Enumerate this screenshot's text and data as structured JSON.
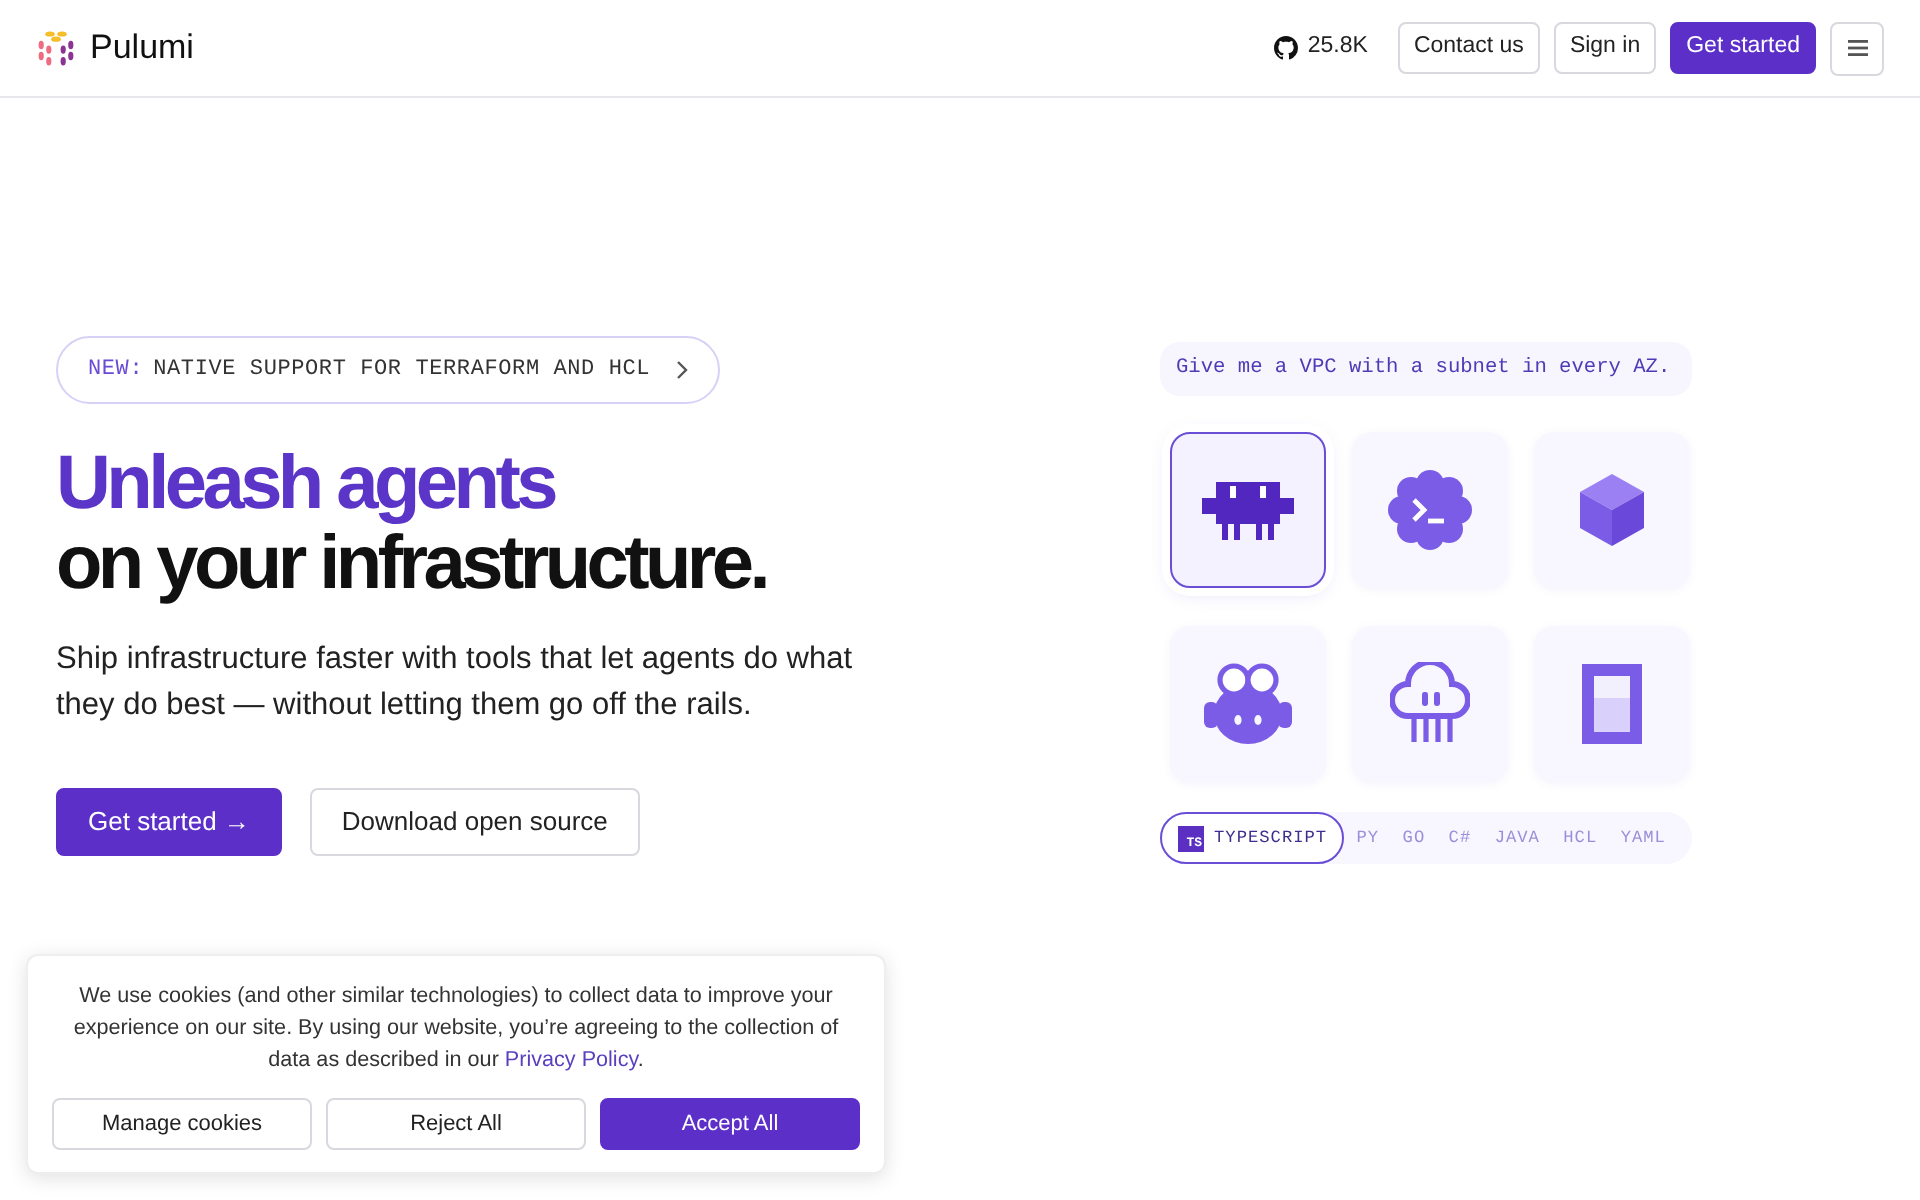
{
  "header": {
    "brand": "Pulumi",
    "github_stars": "25.8K",
    "buttons": [
      {
        "label": "Contact us",
        "kind": "outline"
      },
      {
        "label": "Sign in",
        "kind": "outline"
      },
      {
        "label": "Get started",
        "kind": "primary"
      }
    ]
  },
  "hero": {
    "announcement": {
      "tag": "NEW:",
      "text": "NATIVE SUPPORT FOR TERRAFORM AND HCL"
    },
    "headline_accent": "Unleash agents",
    "headline": "on your infrastructure.",
    "subtitle": "Ship infrastructure faster with tools that let agents do what they do best — without letting them go off the rails.",
    "buttons": [
      {
        "label": "Get started →",
        "kind": "primary"
      },
      {
        "label": "Download open source",
        "kind": "outline"
      }
    ]
  },
  "demo": {
    "prompt": "Give me a VPC with a subnet in every AZ.",
    "agents": [
      {
        "kind": "pixel-bot",
        "selected": true
      },
      {
        "kind": "terminal",
        "selected": false
      },
      {
        "kind": "cube",
        "selected": false
      },
      {
        "kind": "goggles",
        "selected": false
      },
      {
        "kind": "cloud",
        "selected": false
      },
      {
        "kind": "panel",
        "selected": false
      }
    ],
    "languages": [
      {
        "label": "TYPESCRIPT",
        "badge": "TS",
        "selected": true
      },
      {
        "label": "PY",
        "selected": false
      },
      {
        "label": "GO",
        "selected": false
      },
      {
        "label": "C#",
        "selected": false
      },
      {
        "label": "JAVA",
        "selected": false
      },
      {
        "label": "HCL",
        "selected": false
      },
      {
        "label": "YAML",
        "selected": false
      }
    ]
  },
  "cookie_banner": {
    "text": "We use cookies (and other similar technologies) to collect data to improve your experience on our site. By using our website, you’re agreeing to the collection of data as described in our ",
    "link": "Privacy Policy",
    "text_end": ".",
    "buttons": [
      {
        "label": "Manage cookies",
        "kind": "outline"
      },
      {
        "label": "Reject All",
        "kind": "outline"
      },
      {
        "label": "Accept All",
        "kind": "primary"
      }
    ]
  }
}
